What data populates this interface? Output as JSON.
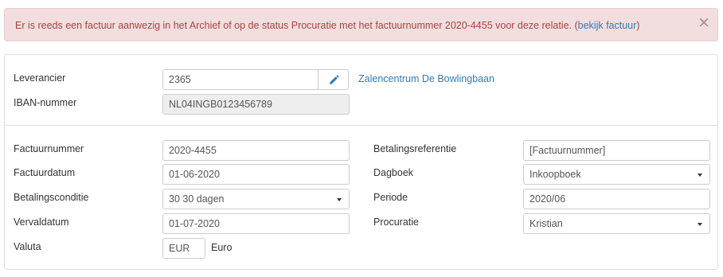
{
  "alert": {
    "message": "Er is reeds een factuur aanwezig in het Archief of op de status Procuratie met het factuurnummer 2020-4455 voor deze relatie. (",
    "link_text": "bekijk factuur",
    "suffix": ")",
    "close": "×"
  },
  "supplier": {
    "leverancier_label": "Leverancier",
    "leverancier_value": "2365",
    "leverancier_name": "Zalencentrum De Bowlingbaan",
    "edit_icon": "pencil-icon",
    "iban_label": "IBAN-nummer",
    "iban_value": "NL04INGB0123456789"
  },
  "invoice": {
    "factuurnummer_label": "Factuurnummer",
    "factuurnummer_value": "2020-4455",
    "factuurdatum_label": "Factuurdatum",
    "factuurdatum_value": "01-06-2020",
    "betalingsconditie_label": "Betalingsconditie",
    "betalingsconditie_value": "30 30 dagen",
    "vervaldatum_label": "Vervaldatum",
    "vervaldatum_value": "01-07-2020",
    "valuta_label": "Valuta",
    "valuta_value": "EUR",
    "valuta_name": "Euro",
    "betalingsreferentie_label": "Betalingsreferentie",
    "betalingsreferentie_value": "[Factuurnummer]",
    "dagboek_label": "Dagboek",
    "dagboek_value": "Inkoopboek",
    "periode_label": "Periode",
    "periode_value": "2020/06",
    "procuratie_label": "Procuratie",
    "procuratie_value": "Kristian"
  },
  "colors": {
    "alert_bg": "#f2dede",
    "alert_text": "#a94442",
    "link": "#337ab7",
    "readonly_bg": "#eeeeee"
  }
}
